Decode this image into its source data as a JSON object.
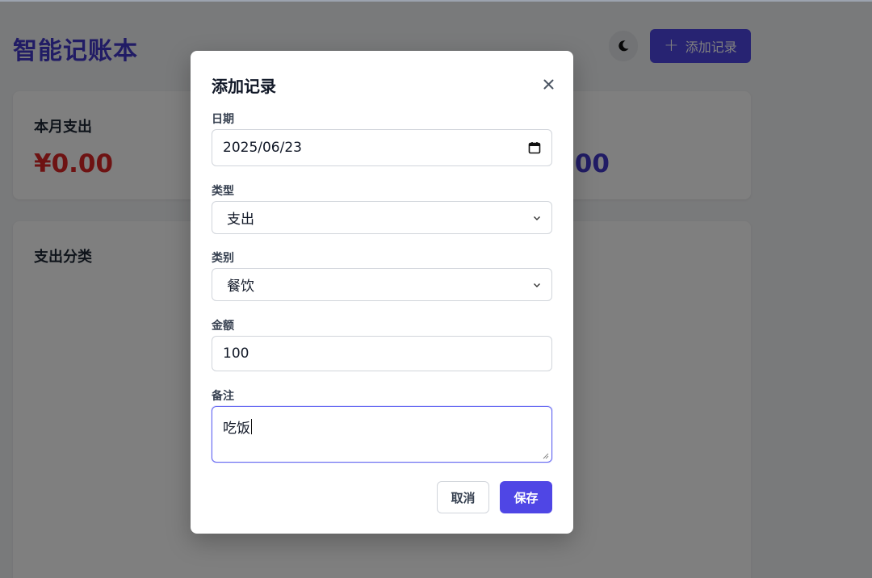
{
  "header": {
    "app_title": "智能记账本",
    "theme_icon": "moon-icon",
    "add_button_label": "添加记录"
  },
  "cards": {
    "month_expense": {
      "label": "本月支出",
      "value": "¥0.00"
    },
    "right_partial_value": ".00",
    "category": {
      "label": "支出分类"
    }
  },
  "modal": {
    "title": "添加记录",
    "close_icon": "close-icon",
    "fields": {
      "date": {
        "label": "日期",
        "value": "2025/06/23",
        "icon": "calendar-icon"
      },
      "type": {
        "label": "类型",
        "value": "支出"
      },
      "category": {
        "label": "类别",
        "value": "餐饮"
      },
      "amount": {
        "label": "金额",
        "value": "100"
      },
      "note": {
        "label": "备注",
        "value": "吃饭"
      }
    },
    "cancel_label": "取消",
    "save_label": "保存"
  },
  "colors": {
    "accent": "#4f46e5",
    "title": "#4338ca",
    "expense": "#dc2626"
  }
}
